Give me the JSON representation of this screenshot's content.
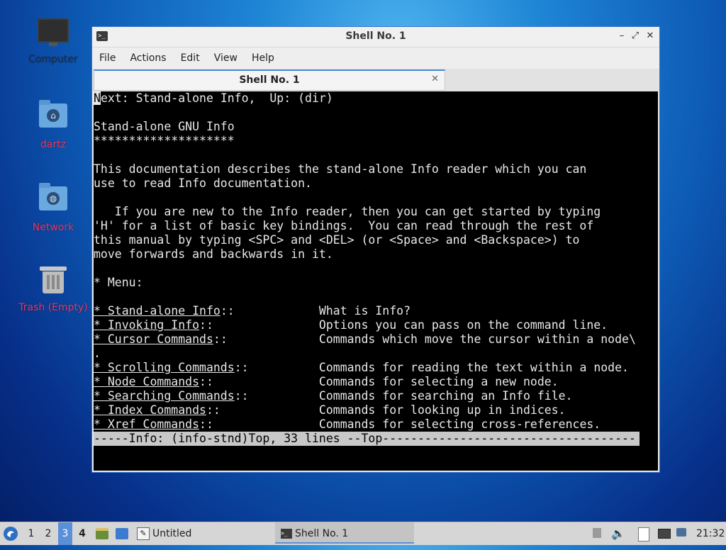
{
  "desktop": {
    "icons": [
      {
        "label": "Computer"
      },
      {
        "label": "dartz"
      },
      {
        "label": "Network"
      },
      {
        "label": "Trash (Empty)"
      }
    ]
  },
  "window": {
    "title": "Shell No. 1",
    "menu": [
      "File",
      "Actions",
      "Edit",
      "View",
      "Help"
    ],
    "tab_label": "Shell No. 1",
    "terminal": {
      "lines": [
        "Next: Stand-alone Info,  Up: (dir)",
        "",
        "Stand-alone GNU Info",
        "********************",
        "",
        "This documentation describes the stand-alone Info reader which you can",
        "use to read Info documentation.",
        "",
        "   If you are new to the Info reader, then you can get started by typing",
        "'H' for a list of basic key bindings.  You can read through the rest of",
        "this manual by typing <SPC> and <DEL> (or <Space> and <Backspace>) to",
        "move forwards and backwards in it.",
        "",
        "* Menu:",
        ""
      ],
      "menu_items": [
        {
          "name": "Stand-alone Info",
          "sep": "::            ",
          "desc": "What is Info?"
        },
        {
          "name": "Invoking Info",
          "sep": "::               ",
          "desc": "Options you can pass on the command line."
        },
        {
          "name": "Cursor Commands",
          "sep": "::             ",
          "desc": "Commands which move the cursor within a node\\"
        },
        {
          "continuation": "."
        },
        {
          "name": "Scrolling Commands",
          "sep": "::          ",
          "desc": "Commands for reading the text within a node."
        },
        {
          "name": "Node Commands",
          "sep": "::               ",
          "desc": "Commands for selecting a new node."
        },
        {
          "name": "Searching Commands",
          "sep": "::          ",
          "desc": "Commands for searching an Info file."
        },
        {
          "name": "Index Commands",
          "sep": "::              ",
          "desc": "Commands for looking up in indices."
        },
        {
          "name": "Xref Commands",
          "sep": "::               ",
          "desc": "Commands for selecting cross-references."
        }
      ],
      "status_line": "-----Info: (info-stnd)Top, 33 lines --Top------------------------------------"
    }
  },
  "taskbar": {
    "workspaces": [
      "1",
      "2",
      "3",
      "4"
    ],
    "active_workspace": "3",
    "tasks": [
      {
        "label": "Untitled"
      },
      {
        "label": "Shell No. 1"
      }
    ],
    "clock": "21:32"
  }
}
